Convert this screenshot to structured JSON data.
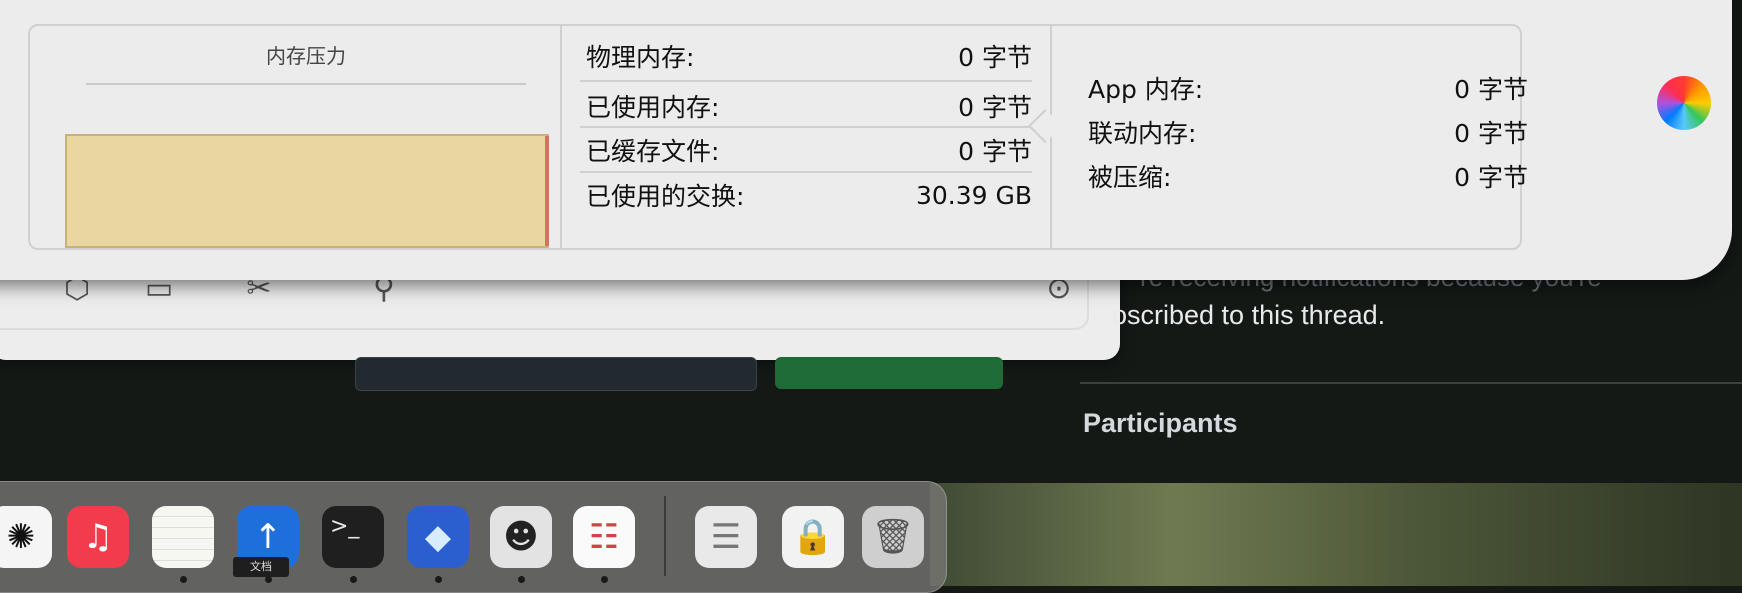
{
  "memory_panel": {
    "pressure_title": "内存压力",
    "stats": [
      {
        "label": "物理内存:",
        "value": "0 字节"
      },
      {
        "label": "已使用内存:",
        "value": "0 字节"
      },
      {
        "label": "已缓存文件:",
        "value": "0 字节"
      },
      {
        "label": "已使用的交换:",
        "value": "30.39 GB"
      }
    ],
    "app_stats": [
      {
        "label": "App 内存:",
        "value": "0 字节"
      },
      {
        "label": "联动内存:",
        "value": "0 字节"
      },
      {
        "label": "被压缩:",
        "value": "0 字节"
      }
    ],
    "pressure_color": "#ead6a0"
  },
  "background_page": {
    "notification_partial": "re receiving notifications because you're",
    "notification_body": "oscribed to this thread.",
    "participants_heading": "Participants"
  },
  "dock": {
    "tooltip": "文档",
    "icons": [
      {
        "name": "chatgpt-icon",
        "glyph": "✺",
        "bg": "#f5f5f5",
        "fg": "#111",
        "running": false
      },
      {
        "name": "music-icon",
        "glyph": "♫",
        "bg": "#f23b4c",
        "fg": "#ffffff",
        "running": false
      },
      {
        "name": "notes-icon",
        "glyph": "",
        "bg": "#f7f7f2",
        "fg": "#999",
        "running": true
      },
      {
        "name": "documents-icon",
        "glyph": "↑",
        "bg": "#1e6fd9",
        "fg": "#ffffff",
        "running": true
      },
      {
        "name": "terminal-icon",
        "glyph": ">_",
        "bg": "#1f1f1f",
        "fg": "#e8e8e8",
        "running": true
      },
      {
        "name": "prism-app-icon",
        "glyph": "◆",
        "bg": "#2b5fcf",
        "fg": "#d8ecff",
        "running": true
      },
      {
        "name": "cat-app-icon",
        "glyph": "☻",
        "bg": "#e3e3e3",
        "fg": "#222",
        "running": true
      },
      {
        "name": "reminders-icon",
        "glyph": "☷",
        "bg": "#fafafa",
        "fg": "#d04444",
        "running": true
      },
      {
        "name": "text-document-icon",
        "glyph": "☰",
        "bg": "#e9e9e9",
        "fg": "#777",
        "running": false
      },
      {
        "name": "locked-file-icon",
        "glyph": "🔒",
        "bg": "#f2f2f2",
        "fg": "#222",
        "running": false
      },
      {
        "name": "trash-icon",
        "glyph": "🗑",
        "bg": "#cfcfcf",
        "fg": "#555",
        "running": false
      }
    ]
  }
}
